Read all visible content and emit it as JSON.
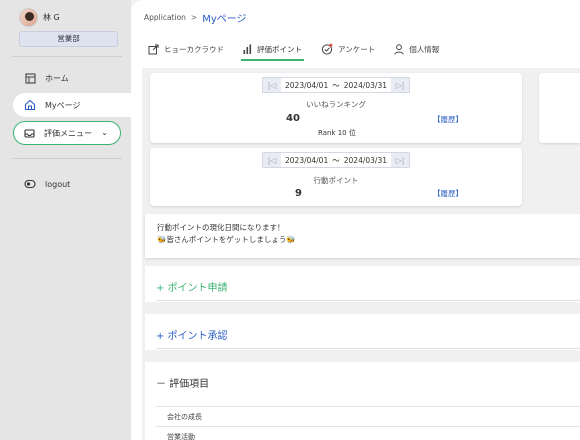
{
  "user": {
    "name": "林 G",
    "department": "営業部"
  },
  "sidebar": {
    "items": [
      {
        "label": "ホーム",
        "icon": "home-icon"
      },
      {
        "label": "Myページ",
        "icon": "house-icon"
      },
      {
        "label": "評価メニュー",
        "icon": "inbox-icon"
      },
      {
        "label": "logout",
        "icon": "logout-icon"
      }
    ]
  },
  "breadcrumb": {
    "root": "Application",
    "separator": ">",
    "current": "Myページ"
  },
  "tabs": [
    {
      "label": "ヒョーカクラウド",
      "icon": "external-link-icon"
    },
    {
      "label": "評価ポイント",
      "icon": "bar-chart-icon"
    },
    {
      "label": "アンケート",
      "icon": "survey-icon"
    },
    {
      "label": "個人情報",
      "icon": "person-icon"
    }
  ],
  "ranking_card": {
    "date_from": "2023/04/01",
    "tilde": "～",
    "date_to": "2024/03/31",
    "label": "いいねランキング",
    "value": "40",
    "link": "【履歴】",
    "rank": "Rank  10 位"
  },
  "points_card": {
    "date_from": "2023/04/01",
    "tilde": "～",
    "date_to": "2024/03/31",
    "label": "行動ポイント",
    "value": "9",
    "link": "【履歴】"
  },
  "notice": {
    "line1": "行動ポイントの現化日間になります！",
    "line2": "🐝皆さんポイントをゲットしましょう🐝"
  },
  "sections": {
    "apply": "+ ポイント申請",
    "approve": "+ ポイント承認",
    "items": "－ 評価項目"
  },
  "eval_items": [
    "会社の成長",
    "営業活動"
  ],
  "colors": {
    "accent_green": "#3cb371",
    "link_blue": "#2b5cc4"
  }
}
